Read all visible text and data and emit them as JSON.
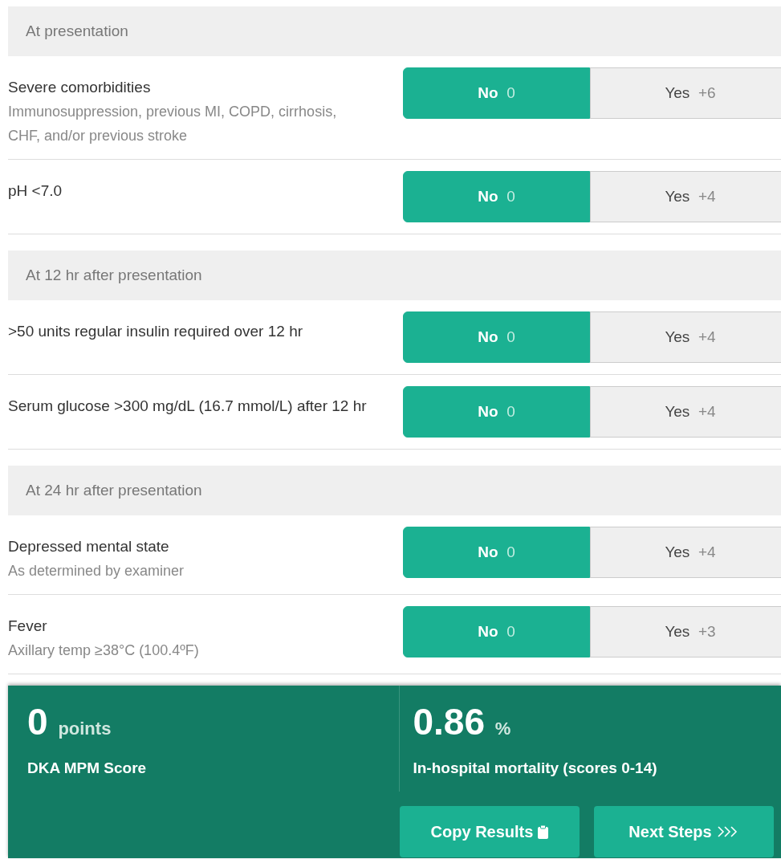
{
  "sections": [
    {
      "title": "At presentation",
      "items": [
        {
          "label": "Severe comorbidities",
          "hint": "Immunosuppression, previous MI, COPD, cirrhosis, CHF, and/or previous stroke",
          "options": [
            {
              "label": "No",
              "points": "0",
              "selected": true
            },
            {
              "label": "Yes",
              "points": "+6",
              "selected": false
            }
          ]
        },
        {
          "label": "pH <7.0",
          "options": [
            {
              "label": "No",
              "points": "0",
              "selected": true
            },
            {
              "label": "Yes",
              "points": "+4",
              "selected": false
            }
          ]
        }
      ]
    },
    {
      "title": "At 12 hr after presentation",
      "items": [
        {
          "label": ">50 units regular insulin required over 12 hr",
          "options": [
            {
              "label": "No",
              "points": "0",
              "selected": true
            },
            {
              "label": "Yes",
              "points": "+4",
              "selected": false
            }
          ]
        },
        {
          "label": "Serum glucose >300 mg/dL (16.7 mmol/L) after 12 hr",
          "options": [
            {
              "label": "No",
              "points": "0",
              "selected": true
            },
            {
              "label": "Yes",
              "points": "+4",
              "selected": false
            }
          ]
        }
      ]
    },
    {
      "title": "At 24 hr after presentation",
      "items": [
        {
          "label": "Depressed mental state",
          "hint": "As determined by examiner",
          "options": [
            {
              "label": "No",
              "points": "0",
              "selected": true
            },
            {
              "label": "Yes",
              "points": "+4",
              "selected": false
            }
          ]
        },
        {
          "label": "Fever",
          "hint": "Axillary temp ≥38°C (100.4ºF)",
          "options": [
            {
              "label": "No",
              "points": "0",
              "selected": true
            },
            {
              "label": "Yes",
              "points": "+3",
              "selected": false
            }
          ]
        }
      ]
    }
  ],
  "result": {
    "score": {
      "value": "0",
      "unit": "points",
      "label": "DKA MPM Score"
    },
    "mortality": {
      "value": "0.86",
      "unit": "%",
      "label": "In-hospital mortality (scores 0-14)"
    },
    "buttons": [
      {
        "label": "Copy Results",
        "kind": "copy"
      },
      {
        "label": "Next Steps",
        "kind": "next"
      }
    ]
  }
}
